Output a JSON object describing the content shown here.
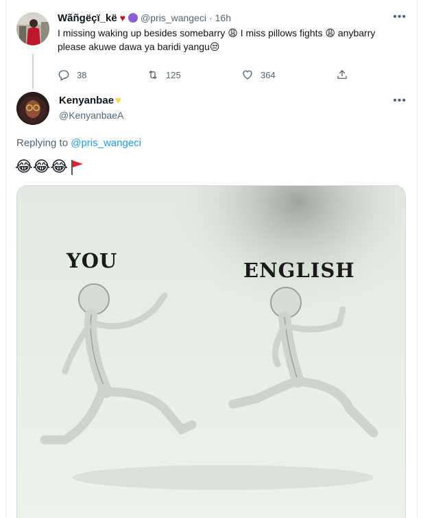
{
  "tweet1": {
    "name": "Wãñgëçï_kë",
    "handle": "@pris_wangeci",
    "time": "16h",
    "text_line1": "I missing waking up besides somebarry 😩 I miss pillows fights 😩 anybarry",
    "text_line2": "please akuwe dawa ya baridi yangu😒",
    "replies": "38",
    "retweets": "125",
    "likes": "364"
  },
  "tweet2": {
    "name": "Kenyanbae",
    "handle": "@KenyanbaeA",
    "replying_label": "Replying to",
    "replying_to": "@pris_wangeci",
    "emoji_text": "😂😂😂"
  },
  "media": {
    "label_left": "YOU",
    "label_right": "ENGLISH"
  },
  "icons": [
    "reply-icon",
    "retweet-icon",
    "like-icon",
    "share-icon",
    "more-icon",
    "red-flag-icon"
  ],
  "colors": {
    "accent": "#1d9bf0",
    "muted": "#536471",
    "text": "#0f1419",
    "border": "#cfd9de"
  }
}
